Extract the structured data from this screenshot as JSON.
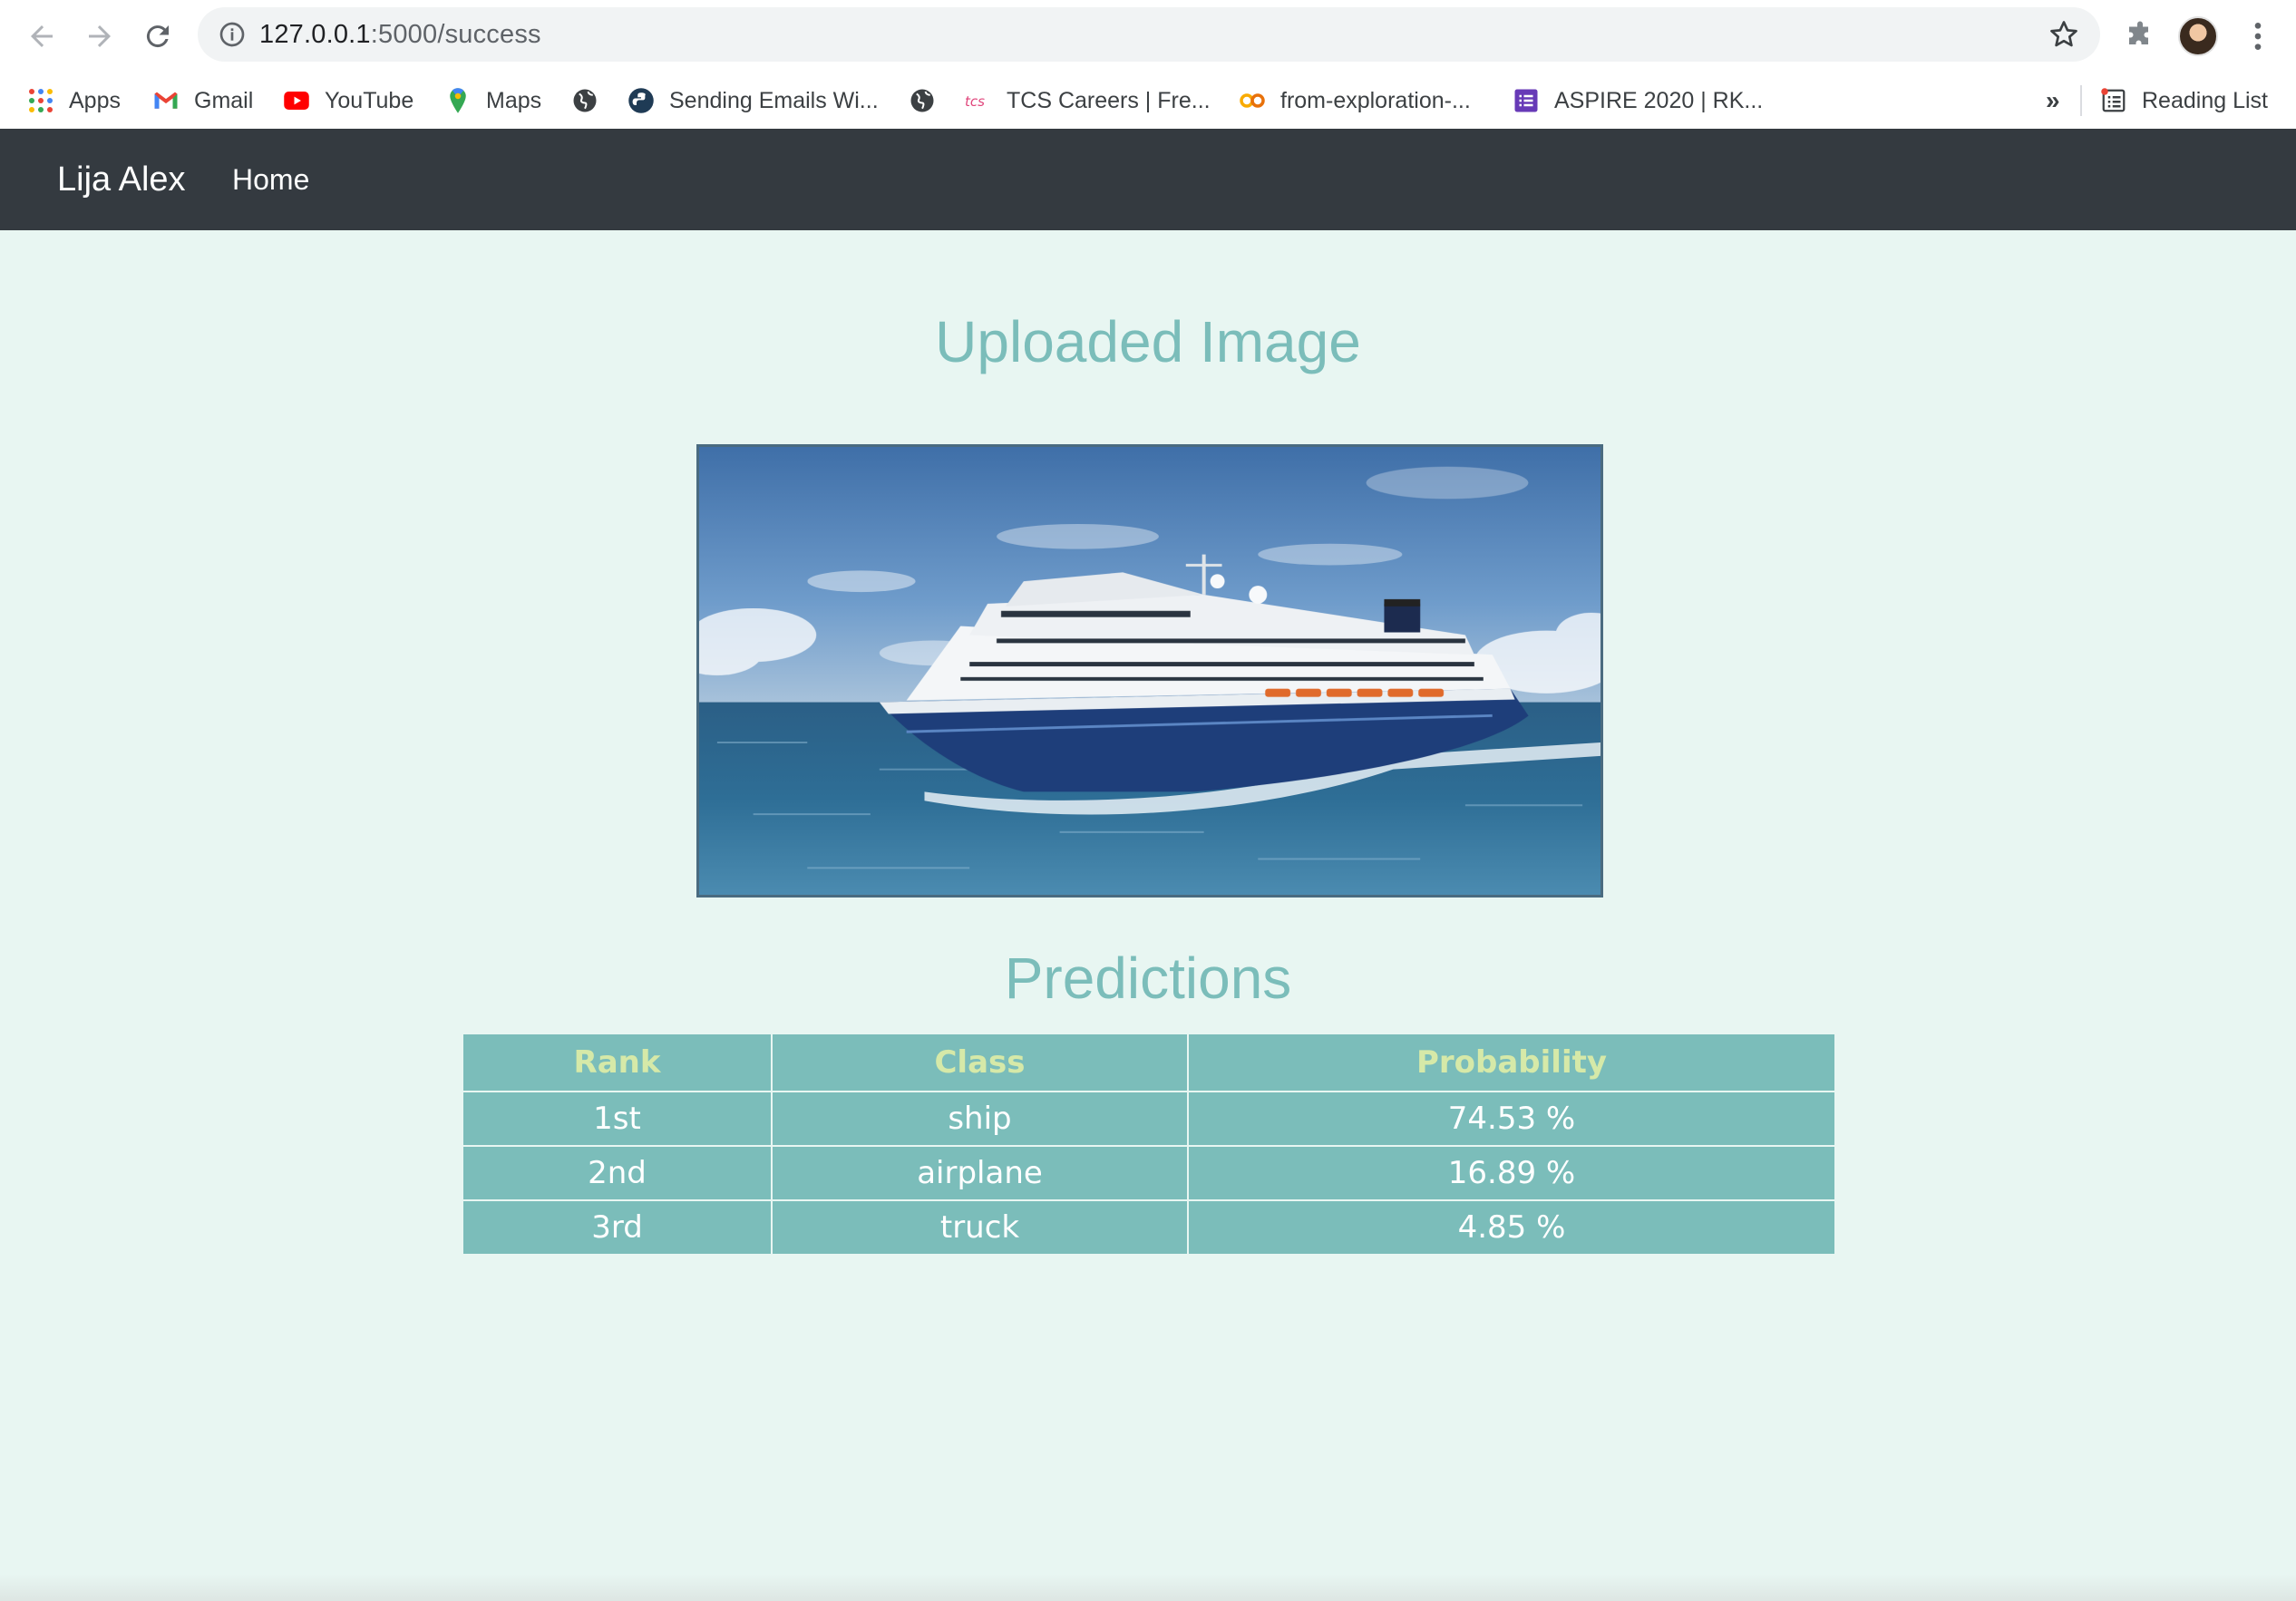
{
  "browser": {
    "url_host": "127.0.0.1",
    "url_path": ":5000/success",
    "bookmarks": [
      {
        "label": "Apps",
        "icon": "apps-grid-icon"
      },
      {
        "label": "Gmail",
        "icon": "gmail-icon"
      },
      {
        "label": "YouTube",
        "icon": "youtube-icon"
      },
      {
        "label": "Maps",
        "icon": "maps-icon"
      },
      {
        "label": "",
        "icon": "globe-icon"
      },
      {
        "label": "Sending Emails Wi...",
        "icon": "python-icon"
      },
      {
        "label": "",
        "icon": "globe-icon"
      },
      {
        "label": "TCS Careers | Fre...",
        "icon": "tcs-icon"
      },
      {
        "label": "from-exploration-...",
        "icon": "colab-icon"
      },
      {
        "label": "ASPIRE 2020 | RK...",
        "icon": "forms-icon"
      }
    ],
    "more_bookmarks": "»",
    "reading_list": "Reading List"
  },
  "navbar": {
    "brand": "Lija Alex",
    "home": "Home"
  },
  "main": {
    "uploaded_heading": "Uploaded Image",
    "predictions_heading": "Predictions",
    "image_alt": "cruise ship"
  },
  "table": {
    "headers": [
      "Rank",
      "Class",
      "Probability"
    ],
    "rows": [
      {
        "rank": "1st",
        "class": "ship",
        "probability": "74.53 %"
      },
      {
        "rank": "2nd",
        "class": "airplane",
        "probability": "16.89 %"
      },
      {
        "rank": "3rd",
        "class": "truck",
        "probability": "4.85 %"
      }
    ]
  },
  "colors": {
    "navbar": "#343a40",
    "page_bg": "#e8f6f2",
    "accent": "#7bbdba",
    "header_text": "#d6e9a8"
  }
}
